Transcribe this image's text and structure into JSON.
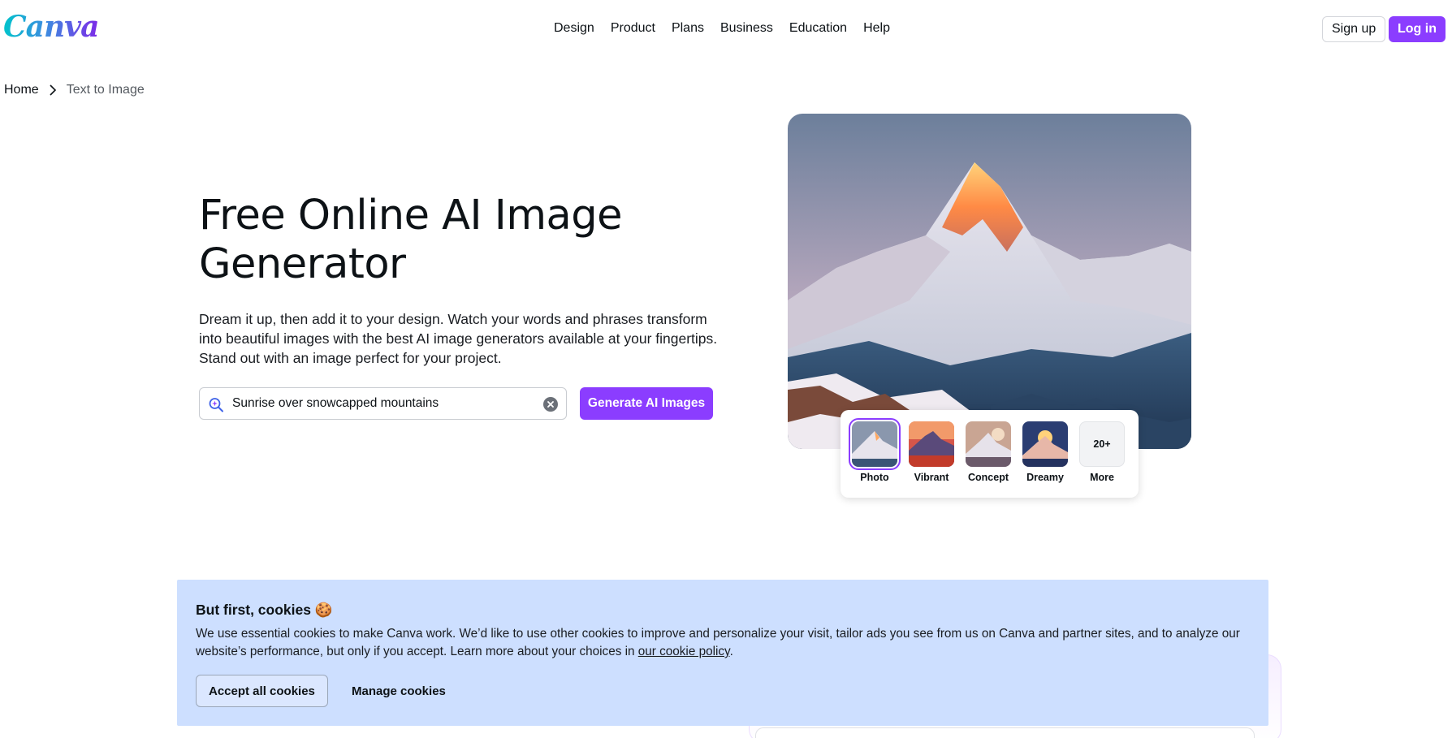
{
  "header": {
    "logo_text": "Canva",
    "nav": [
      "Design",
      "Product",
      "Plans",
      "Business",
      "Education",
      "Help"
    ],
    "signup_label": "Sign up",
    "login_label": "Log in"
  },
  "breadcrumb": {
    "home": "Home",
    "current": "Text to Image"
  },
  "hero": {
    "title": "Free Online AI Image Generator",
    "description": "Dream it up, then add it to your design. Watch your words and phrases transform into beautiful images with the best AI image generators available at your fingertips. Stand out with an image perfect for your project.",
    "search": {
      "value": "Sunrise over snowcapped mountains"
    },
    "generate_label": "Generate AI Images",
    "styles": [
      {
        "label": "Photo",
        "selected": true
      },
      {
        "label": "Vibrant",
        "selected": false
      },
      {
        "label": "Concept",
        "selected": false
      },
      {
        "label": "Dreamy",
        "selected": false
      }
    ],
    "more": {
      "count": "20+",
      "label": "More"
    }
  },
  "cookie_banner": {
    "title": "But first, cookies 🍪",
    "text_before_link": "We use essential cookies to make Canva work. We’d like to use other cookies to improve and personalize your visit, tailor ads you see from us on Canva and partner sites, and to analyze our website’s performance, but only if you accept. Learn more about your choices in ",
    "link_text": "our cookie policy",
    "text_after_link": ".",
    "accept_label": "Accept all cookies",
    "manage_label": "Manage cookies"
  },
  "colors": {
    "brand_purple": "#8b3dff",
    "cookie_bg": "#cddfff"
  }
}
